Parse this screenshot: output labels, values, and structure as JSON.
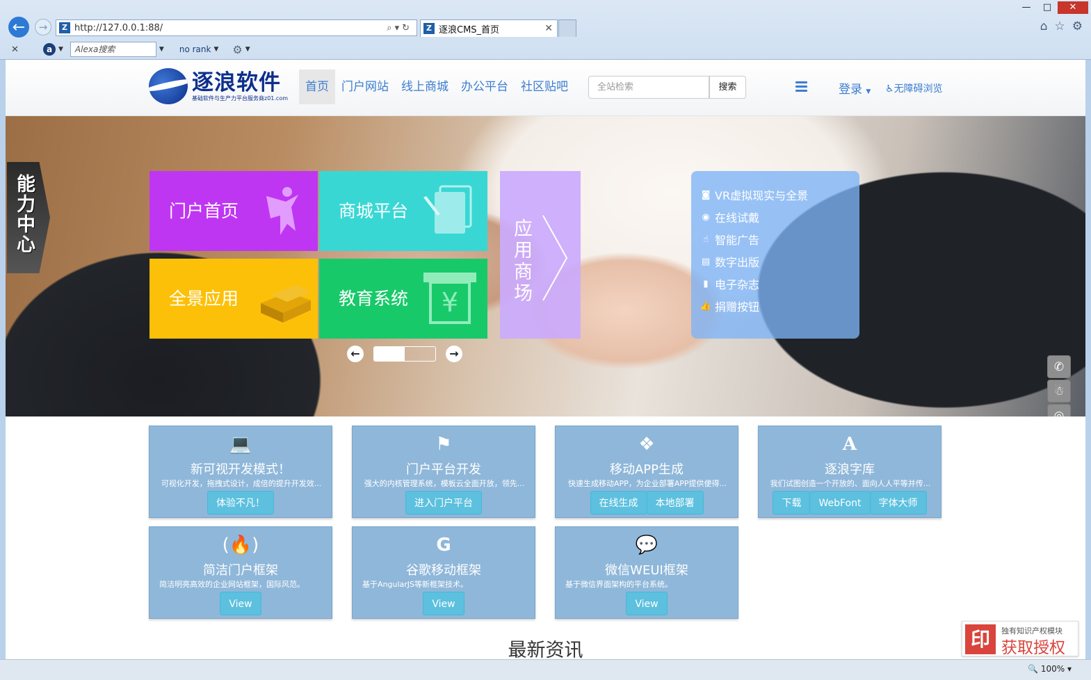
{
  "browser": {
    "address": "http://127.0.0.1:88/",
    "tab_title": "逐浪CMS_首页",
    "toolbar_search_placeholder": "Alexa搜索",
    "rank_text": "no rank",
    "zoom": "100%"
  },
  "header": {
    "logo_title": "逐浪软件",
    "logo_sub": "基础软件与生产力平台服务商z01.com",
    "nav": [
      "首页",
      "门户网站",
      "线上商城",
      "办公平台",
      "社区贴吧"
    ],
    "search_placeholder": "全站检索",
    "search_button": "搜索",
    "login": "登录",
    "accessibility": "无障碍浏览"
  },
  "hero": {
    "side_tab": "能力中心",
    "tiles": [
      "门户首页",
      "商城平台",
      "全景应用",
      "教育系统",
      "应用商场"
    ],
    "slider_progress": 0.5,
    "vr_list": [
      {
        "icon": "vr-goggles-icon",
        "label": "VR虚拟现实与全景"
      },
      {
        "icon": "eye-icon",
        "label": "在线试戴"
      },
      {
        "icon": "hand-icon",
        "label": "智能广告"
      },
      {
        "icon": "publish-icon",
        "label": "数字出版"
      },
      {
        "icon": "book-icon",
        "label": "电子杂志"
      },
      {
        "icon": "thumbs-up-icon",
        "label": "捐赠按钮"
      }
    ]
  },
  "cards": [
    {
      "icon": "laptop-icon",
      "title": "新可视开发模式！",
      "desc": "可视化开发，拖拽式设计，成倍的提升开发效...",
      "buttons": [
        "体验不凡！"
      ]
    },
    {
      "icon": "flag-icon",
      "title": "门户平台开发",
      "desc": "强大的内核管理系统，模板云全面开放，领先...",
      "buttons": [
        "进入门户平台"
      ]
    },
    {
      "icon": "cubes-icon",
      "title": "移动APP生成",
      "desc": "快速生成移动APP，为企业部署APP提供便得...",
      "buttons": [
        "在线生成",
        "本地部署"
      ]
    },
    {
      "icon": "font-icon",
      "title": "逐浪字库",
      "desc": "我们试图创造一个开放的、面向人人平等并传...",
      "buttons": [
        "下载",
        "WebFont",
        "字体大师"
      ]
    },
    {
      "icon": "fire-icon",
      "title": "简洁门户框架",
      "desc": "简洁明亮高效的企业网站框架，国际风范。",
      "buttons": [
        "View"
      ]
    },
    {
      "icon": "google-icon",
      "title": "谷歌移动框架",
      "desc": "基于AngularJS等新框架技术。",
      "buttons": [
        "View"
      ]
    },
    {
      "icon": "wechat-icon",
      "title": "微信WEUI框架",
      "desc": "基于微信界面架构的平台系统。",
      "buttons": [
        "View"
      ]
    }
  ],
  "news_heading": "最新资讯",
  "license": {
    "small": "独有知识产权模块",
    "large": "获取授权",
    "mark": "印"
  }
}
